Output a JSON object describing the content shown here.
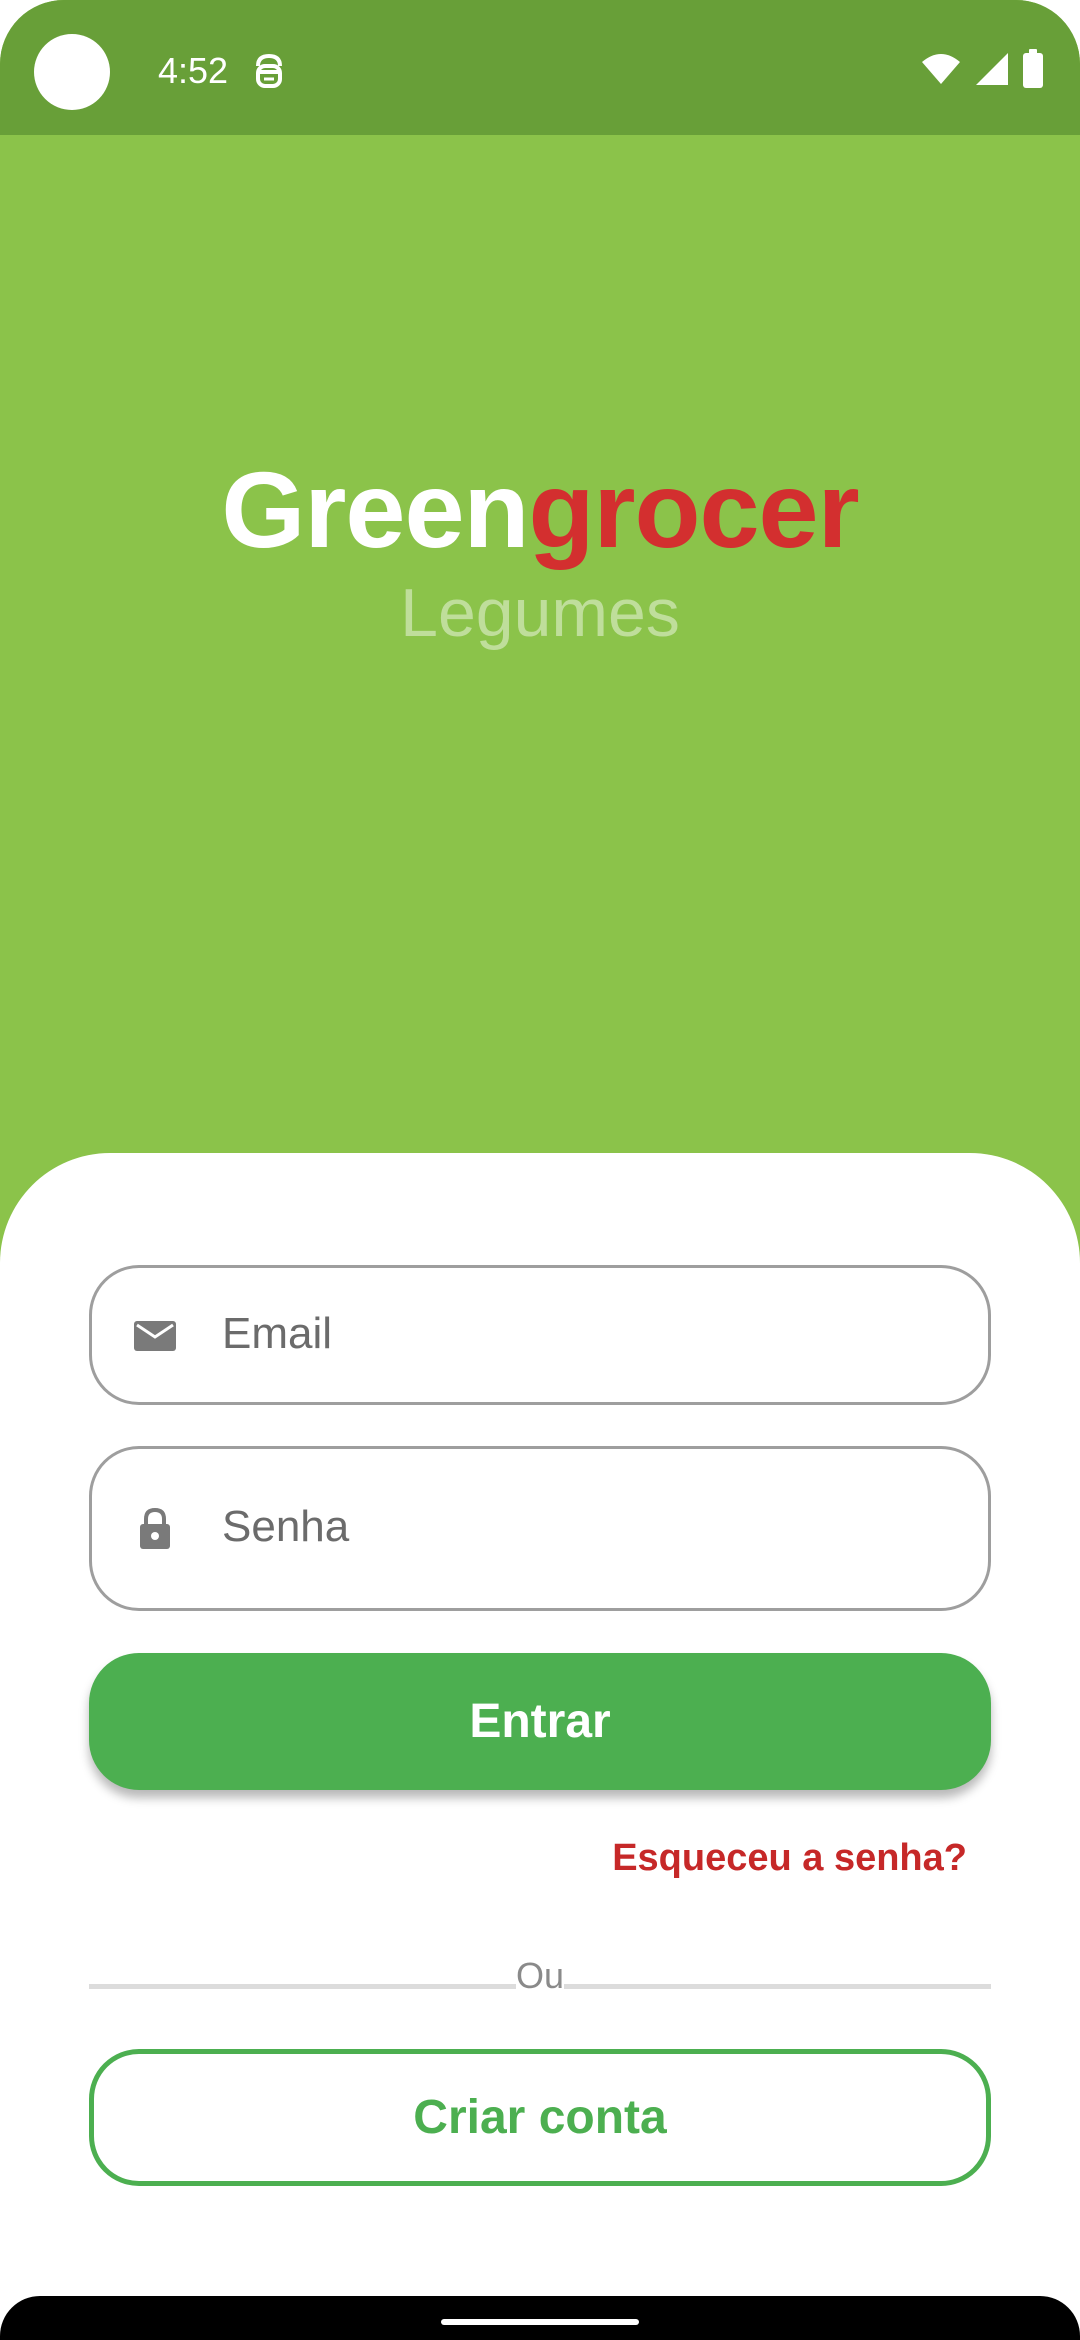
{
  "status_bar": {
    "time": "4:52",
    "icons": [
      "camera-dot",
      "app-notification-icon",
      "wifi-icon",
      "signal-icon",
      "battery-icon"
    ]
  },
  "brand": {
    "title_part1": "Green",
    "title_part2": "grocer",
    "subtitle": "Legumes"
  },
  "form": {
    "email_placeholder": "Email",
    "password_placeholder": "Senha",
    "login_button": "Entrar",
    "forgot_password": "Esqueceu a senha?",
    "divider_text": "Ou",
    "create_account_button": "Criar conta"
  },
  "colors": {
    "background": "#8bc34a",
    "status_bar": "#689f38",
    "primary": "#4caf50",
    "accent_red": "#d32f2f"
  }
}
